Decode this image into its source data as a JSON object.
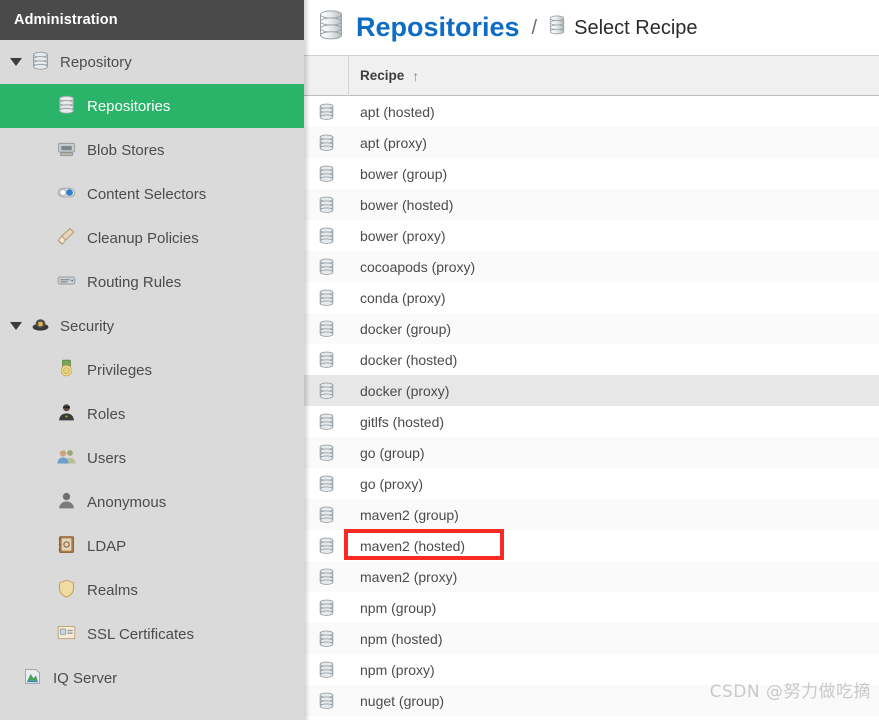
{
  "sidebar": {
    "header_title": "Administration",
    "groups": [
      {
        "label": "Repository",
        "icon": "database-icon",
        "expanded": true,
        "items": [
          {
            "label": "Repositories",
            "icon": "database-icon",
            "selected": true
          },
          {
            "label": "Blob Stores",
            "icon": "blob-store-icon",
            "selected": false
          },
          {
            "label": "Content Selectors",
            "icon": "content-selector-icon",
            "selected": false
          },
          {
            "label": "Cleanup Policies",
            "icon": "broom-icon",
            "selected": false
          },
          {
            "label": "Routing Rules",
            "icon": "routing-rules-icon",
            "selected": false
          }
        ]
      },
      {
        "label": "Security",
        "icon": "security-badge-icon",
        "expanded": true,
        "items": [
          {
            "label": "Privileges",
            "icon": "medal-icon",
            "selected": false
          },
          {
            "label": "Roles",
            "icon": "roles-person-icon",
            "selected": false
          },
          {
            "label": "Users",
            "icon": "users-icon",
            "selected": false
          },
          {
            "label": "Anonymous",
            "icon": "anonymous-icon",
            "selected": false
          },
          {
            "label": "LDAP",
            "icon": "ldap-book-icon",
            "selected": false
          },
          {
            "label": "Realms",
            "icon": "shield-icon",
            "selected": false
          },
          {
            "label": "SSL Certificates",
            "icon": "certificate-icon",
            "selected": false
          }
        ]
      }
    ],
    "root_items": [
      {
        "label": "IQ Server",
        "icon": "iq-server-icon",
        "selected": false
      }
    ]
  },
  "breadcrumb": {
    "main_label": "Repositories",
    "main_icon": "database-icon",
    "separator": "/",
    "sub_label": "Select Recipe",
    "sub_icon": "database-icon",
    "main_color": "#0e6dc2"
  },
  "grid": {
    "columns": [
      {
        "key": "icon",
        "label": ""
      },
      {
        "key": "recipe",
        "label": "Recipe",
        "sort": "asc",
        "sort_glyph": "↑"
      }
    ],
    "rows": [
      {
        "recipe": "apt (hosted)",
        "icon": "repository-icon",
        "state": "normal"
      },
      {
        "recipe": "apt (proxy)",
        "icon": "repository-icon",
        "state": "alt"
      },
      {
        "recipe": "bower (group)",
        "icon": "repository-icon",
        "state": "normal"
      },
      {
        "recipe": "bower (hosted)",
        "icon": "repository-icon",
        "state": "alt"
      },
      {
        "recipe": "bower (proxy)",
        "icon": "repository-icon",
        "state": "normal"
      },
      {
        "recipe": "cocoapods (proxy)",
        "icon": "repository-icon",
        "state": "alt"
      },
      {
        "recipe": "conda (proxy)",
        "icon": "repository-icon",
        "state": "normal"
      },
      {
        "recipe": "docker (group)",
        "icon": "repository-icon",
        "state": "alt"
      },
      {
        "recipe": "docker (hosted)",
        "icon": "repository-icon",
        "state": "normal"
      },
      {
        "recipe": "docker (proxy)",
        "icon": "repository-icon",
        "state": "hover"
      },
      {
        "recipe": "gitlfs (hosted)",
        "icon": "repository-icon",
        "state": "normal"
      },
      {
        "recipe": "go (group)",
        "icon": "repository-icon",
        "state": "alt"
      },
      {
        "recipe": "go (proxy)",
        "icon": "repository-icon",
        "state": "normal"
      },
      {
        "recipe": "maven2 (group)",
        "icon": "repository-icon",
        "state": "alt"
      },
      {
        "recipe": "maven2 (hosted)",
        "icon": "repository-icon",
        "state": "normal",
        "annotated": true
      },
      {
        "recipe": "maven2 (proxy)",
        "icon": "repository-icon",
        "state": "alt"
      },
      {
        "recipe": "npm (group)",
        "icon": "repository-icon",
        "state": "normal"
      },
      {
        "recipe": "npm (hosted)",
        "icon": "repository-icon",
        "state": "alt"
      },
      {
        "recipe": "npm (proxy)",
        "icon": "repository-icon",
        "state": "normal"
      },
      {
        "recipe": "nuget (group)",
        "icon": "repository-icon",
        "state": "alt"
      }
    ]
  },
  "annotation": {
    "color": "#fb2a25",
    "target_recipe": "maven2 (hosted)"
  },
  "watermark": {
    "text": "CSDN @努力做吃摘"
  }
}
